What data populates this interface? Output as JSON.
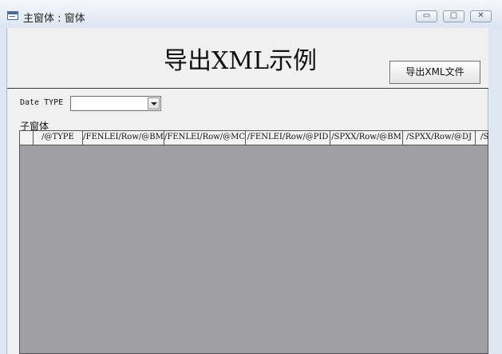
{
  "window": {
    "title": "主窗体 : 窗体",
    "buttons": {
      "minimize": "▭",
      "restore": "▢",
      "close": "✕"
    }
  },
  "form": {
    "title": "导出XML示例",
    "export_button": "导出XML文件",
    "date_label": "Date TYPE",
    "date_value": "",
    "subform_label": "子窗体"
  },
  "grid": {
    "columns": [
      "/@TYPE",
      "/FENLEI/Row/@BM",
      "/FENLEI/Row/@MC",
      "/FENLEI/Row/@PID",
      "/SPXX/Row/@BM",
      "/SPXX/Row/@DJ",
      "/S"
    ]
  }
}
